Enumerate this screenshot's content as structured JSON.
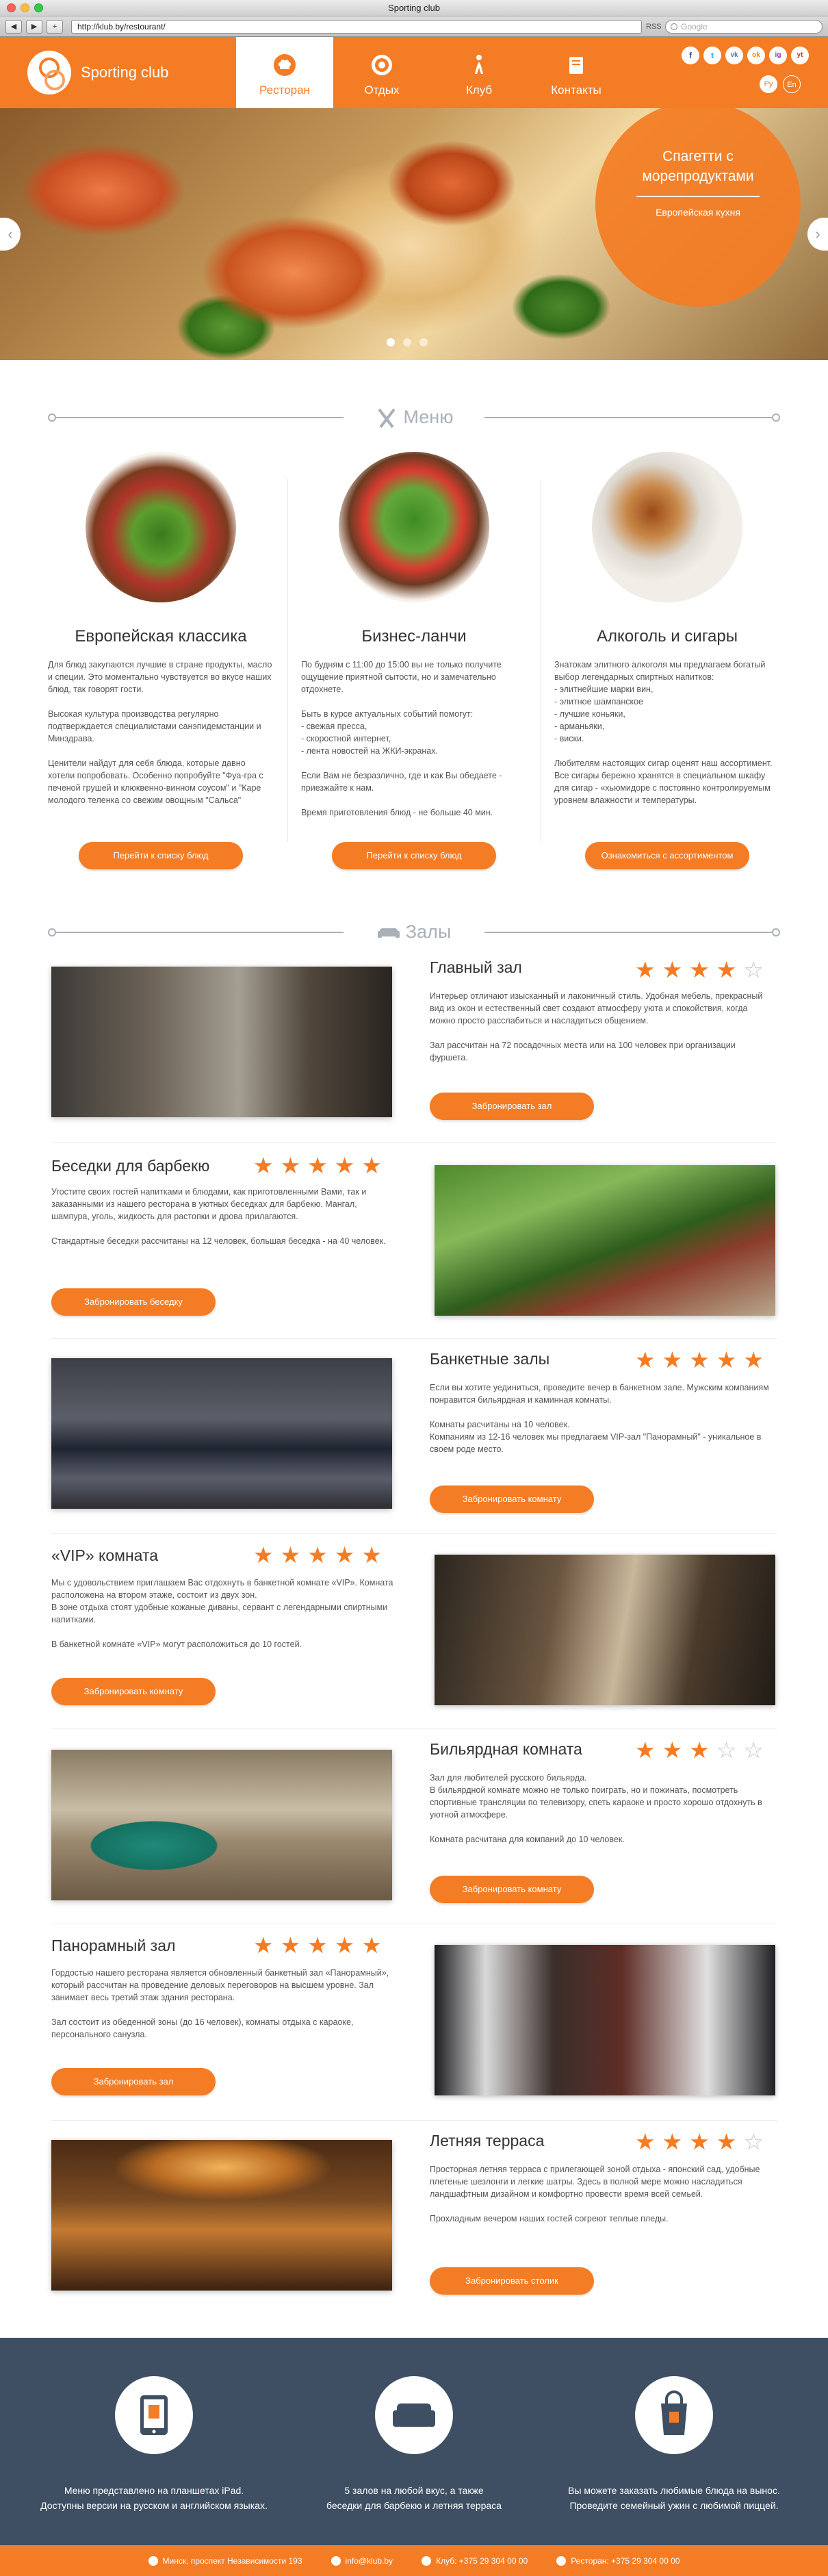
{
  "browser": {
    "title": "Sporting club",
    "url": "http://klub.by/restourant/",
    "search_placeholder": "Google",
    "back": "◀",
    "forward": "▶",
    "add": "+",
    "rss": "RSS"
  },
  "header": {
    "brand": "Sporting club",
    "nav": [
      {
        "label": "Ресторан",
        "icon": "chef-hat-icon",
        "active": true
      },
      {
        "label": "Отдых",
        "icon": "target-icon",
        "active": false
      },
      {
        "label": "Клуб",
        "icon": "rider-icon",
        "active": false
      },
      {
        "label": "Контакты",
        "icon": "book-icon",
        "active": false
      }
    ],
    "social": [
      "f",
      "t",
      "vk",
      "ok",
      "ig",
      "yt"
    ],
    "lang": [
      "Ру",
      "En"
    ],
    "colors": {
      "accent": "#f47c24",
      "band": "#3e4f63"
    }
  },
  "hero": {
    "title": "Спагетти с морепродуктами",
    "subtitle": "Европейская кухня",
    "prev": "‹",
    "next": "›",
    "slides": 3,
    "active_slide": 1
  },
  "menu": {
    "heading": "Меню",
    "columns": [
      {
        "title": "Европейская классика",
        "text": "Для блюд закупаются лучшие в стране продукты, масло и специи. Это моментально чувствуется во вкусе наших блюд, так говорят гости.\n\nВысокая культура производства регулярно подтверждается специалистами санэпидемстанции и Минздрава.\n\nЦенители найдут для себя блюда, которые давно хотели попробовать. Особенно попробуйте \"Фуа-гра с печеной грушей и клюквенно-винном соусом\" и \"Каре молодого теленка со свежим овощным \"Сальса\"",
        "button": "Перейти к списку блюд"
      },
      {
        "title": "Бизнес-ланчи",
        "text": "По будням с 11:00 до 15:00 вы не только получите ощущение приятной сытости, но и замечательно отдохнете.\n\nБыть в курсе актуальных событий помогут:\n- свежая пресса,\n- скоростной интернет,\n- лента новостей на ЖКИ-экранах.\n\nЕсли Вам не безразлично, где и как Вы обедаете - приезжайте к нам.\n\nВремя приготовления блюд - не больше 40 мин.",
        "button": "Перейти к списку блюд"
      },
      {
        "title": "Алкоголь и сигары",
        "text": "Знатокам элитного алкоголя мы предлагаем богатый выбор легендарных спиртных напитков:\n- элитнейшие марки вин,\n- элитное шампанское\n- лучшие коньяки,\n- арманьяки,\n- виски.\n\nЛюбителям настоящих сигар оценят наш ассортимент. Все сигары бережно хранятся в специальном шкафу для сигар - «хьюмидоре с постоянно контролируемым уровнем влажности и температуры.",
        "button": "Ознакомиться с ассортиментом"
      }
    ]
  },
  "halls": {
    "heading": "Залы",
    "items": [
      {
        "title": "Главный зал",
        "rating": 4,
        "text": "Интерьер отличают изысканный и лаконичный стиль. Удобная мебель, прекрасный вид из окон и естественный свет создают атмосферу уюта и спокойствия, когда можно просто расслабиться и насладиться общением.\n\nЗал рассчитан на 72 посадочных места или на 100 человек при организации фуршета.",
        "button": "Забронировать зал"
      },
      {
        "title": "Беседки для барбекю",
        "rating": 5,
        "text": "Угостите своих гостей напитками и блюдами, как приготовленными Вами, так и заказанными из нашего ресторана в уютных беседках для барбекю. Мангал, шампура, уголь, жидкость для растопки и дрова прилагаются.\n\nСтандартные беседки рассчитаны на 12 человек, большая беседка - на 40 человек.",
        "button": "Забронировать беседку"
      },
      {
        "title": "Банкетные залы",
        "rating": 5,
        "text": "Если вы хотите уединиться, проведите вечер в банкетном зале. Мужским компаниям понравится бильярдная и каминная комнаты.\n\nКомнаты расчитаны на 10 человек.\nКомпаниям из 12-16 человек мы предлагаем VIP-зал \"Панорамный\" - уникальное в своем роде место.",
        "button": "Забронировать комнату"
      },
      {
        "title": "«VIP» комната",
        "rating": 5,
        "text": "Мы с удовольствием приглашаем Вас отдохнуть в банкетной комнате «VIP». Комната расположена на втором этаже, состоит из двух зон.\nВ зоне отдыха стоят удобные кожаные диваны, сервант с легендарными спиртными напитками.\n\nВ банкетной комнате «VIP» могут расположиться до 10 гостей.",
        "button": "Забронировать комнату"
      },
      {
        "title": "Бильярдная комната",
        "rating": 3,
        "text": "Зал для любителей русского бильярда.\nВ бильярдной комнате можно не только поиграть, но и пожинать, посмотреть спортивные трансляции по телевизору, спеть караоке и просто хорошо отдохнуть в уютной атмосфере.\n\nКомната расчитана для компаний до 10 человек.",
        "button": "Забронировать комнату"
      },
      {
        "title": "Панорамный зал",
        "rating": 5,
        "text": "Гордостью нашего ресторана является обновленный банкетный зал «Панорамный», который рассчитан на проведение деловых переговоров на высшем уровне. Зал занимает весь третий этаж здания ресторана.\n\nЗал состоит из обеденной зоны (до 16 человек), комнаты отдыха с караоке, персонального санузла.",
        "button": "Забронировать зал"
      },
      {
        "title": "Летняя терраса",
        "rating": 4,
        "text": "Просторная летняя терраса с прилегающей зоной отдыха - японский сад, удобные плетеные шезлонги и легкие шатры. Здесь в полной мере можно насладиться ландшафтным дизайном и комфортно провести время всей семьей.\n\nПрохладным вечером наших гостей согреют теплые пледы.",
        "button": "Забронировать столик"
      }
    ]
  },
  "features": [
    {
      "icon": "tablet-icon",
      "text": "Меню представлено на планшетах iPad.\nДоступны версии на русском и английском языках."
    },
    {
      "icon": "sofa-icon",
      "text": "5 залов на любой вкус, а также\nбеседки для барбекю и летняя терраса"
    },
    {
      "icon": "takeaway-bag-icon",
      "text": "Вы можете заказать любимые блюда на вынос.\nПроведите семейный ужин с любимой пиццей."
    }
  ],
  "footer": {
    "address": "Минск, проспект Независимости 193",
    "email": "info@klub.by",
    "club_phone": "Клуб: +375 29 304 00 00",
    "restaurant_phone": "Ресторан: +375 29 304 00 00"
  }
}
